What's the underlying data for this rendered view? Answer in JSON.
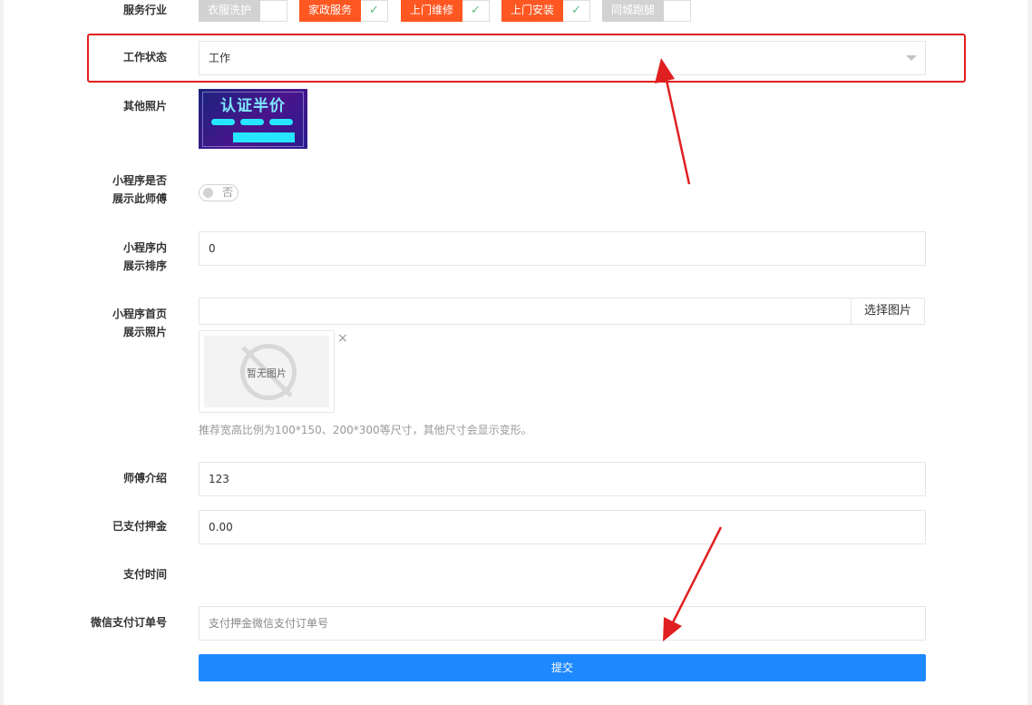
{
  "form": {
    "service_industry": {
      "label": "服务行业",
      "tags": [
        {
          "name": "衣服洗护",
          "selected": false
        },
        {
          "name": "家政服务",
          "selected": true
        },
        {
          "name": "上门维修",
          "selected": true
        },
        {
          "name": "上门安装",
          "selected": true
        },
        {
          "name": "同城跑腿",
          "selected": false
        }
      ],
      "check_glyph": "✓"
    },
    "work_status": {
      "label": "工作状态",
      "value": "工作"
    },
    "other_photos": {
      "label": "其他照片",
      "banner_text": "认证半价"
    },
    "show_in_miniapp": {
      "label_line1": "小程序是否",
      "label_line2": "展示此师傅",
      "state_text": "否",
      "on": false
    },
    "miniapp_sort": {
      "label_line1": "小程序内",
      "label_line2": "展示排序",
      "value": "0"
    },
    "miniapp_home_photo": {
      "label_line1": "小程序首页",
      "label_line2": "展示照片",
      "value": "",
      "select_button": "选择图片",
      "no_image_text": "暂无图片",
      "remove_glyph": "×",
      "hint": "推荐宽高比例为100*150、200*300等尺寸，其他尺寸会显示变形。"
    },
    "master_intro": {
      "label": "师傅介绍",
      "value": "123"
    },
    "deposit_paid": {
      "label": "已支付押金",
      "value": "0.00"
    },
    "pay_time": {
      "label": "支付时间",
      "value": ""
    },
    "wechat_order_no": {
      "label": "微信支付订单号",
      "value": "",
      "placeholder": "支付押金微信支付订单号"
    },
    "submit_label": "提交"
  },
  "colors": {
    "tag_selected": "#ff5722",
    "tag_unselected": "#d2d2d2",
    "submit": "#1e88ff",
    "annotation": "#e02020"
  },
  "icons": [
    "check-icon",
    "dropdown-arrow-icon",
    "no-image-icon",
    "close-icon",
    "annotation-arrow-icon"
  ]
}
